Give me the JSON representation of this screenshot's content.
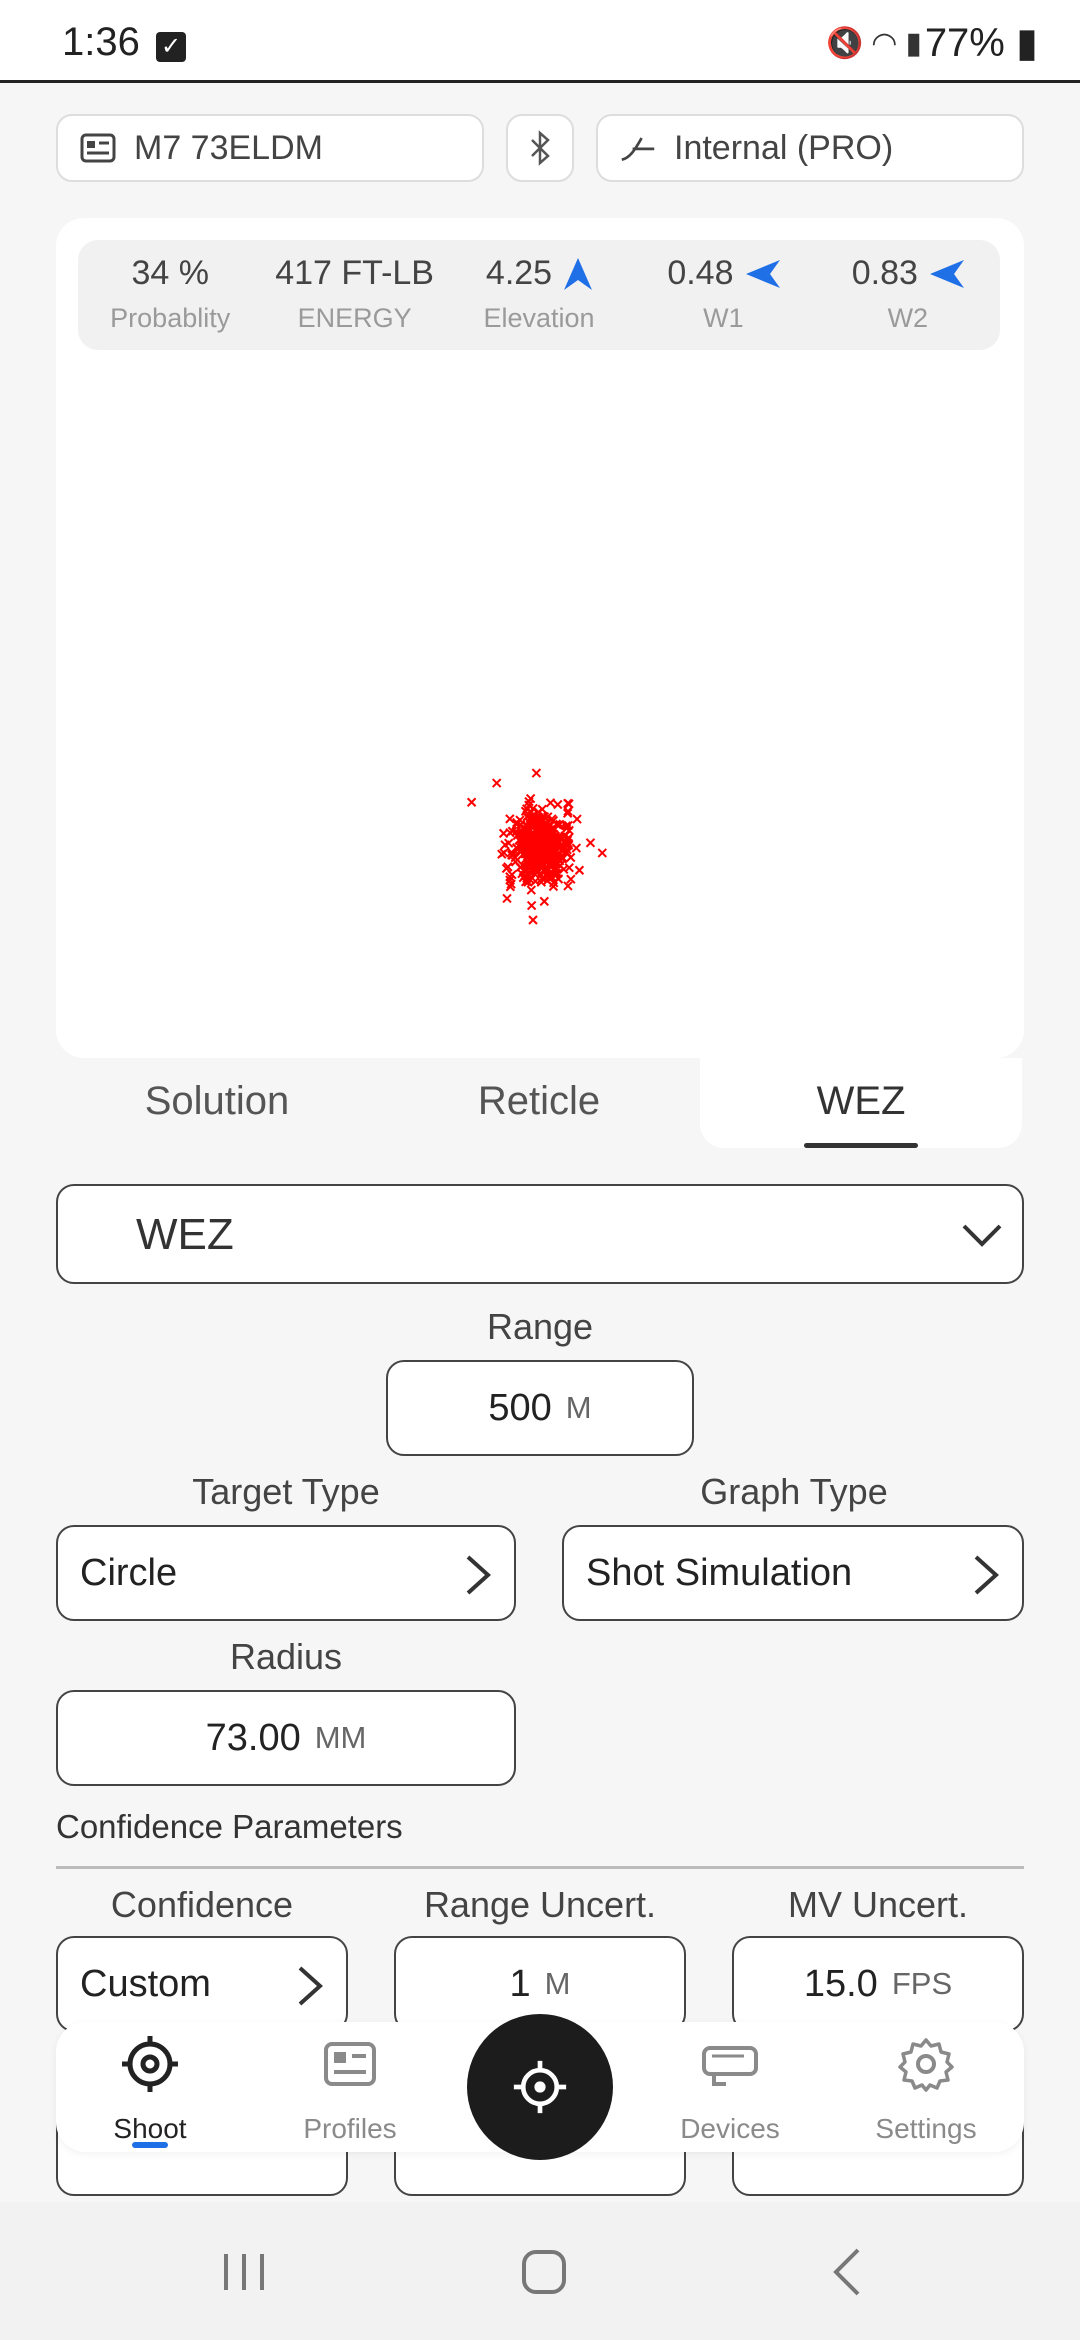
{
  "status_bar": {
    "time": "1:36",
    "battery": "77%"
  },
  "top_bar": {
    "profile_name": "M7 73ELDM",
    "solver": "Internal (PRO)"
  },
  "metrics": [
    {
      "value": "34 %",
      "label": "Probablity"
    },
    {
      "value": "417 FT-LB",
      "label": "ENERGY"
    },
    {
      "value": "4.25",
      "label": "Elevation",
      "arrow": "up"
    },
    {
      "value": "0.48",
      "label": "W1",
      "arrow": "left"
    },
    {
      "value": "0.83",
      "label": "W2",
      "arrow": "left"
    }
  ],
  "tabs": [
    {
      "label": "Solution",
      "active": false
    },
    {
      "label": "Reticle",
      "active": false
    },
    {
      "label": "WEZ",
      "active": true
    }
  ],
  "wez": {
    "mode": "WEZ",
    "range_label": "Range",
    "range_value": "500",
    "range_unit": "M",
    "target_type_label": "Target Type",
    "target_type_value": "Circle",
    "graph_type_label": "Graph Type",
    "graph_type_value": "Shot Simulation",
    "radius_label": "Radius",
    "radius_value": "73.00",
    "radius_unit": "MM"
  },
  "confidence": {
    "section_title": "Confidence Parameters",
    "confidence_label": "Confidence",
    "confidence_value": "Custom",
    "range_uncert_label": "Range Uncert.",
    "range_uncert_value": "1",
    "range_uncert_unit": "M",
    "mv_uncert_label": "MV Uncert.",
    "mv_uncert_value": "15.0",
    "mv_uncert_unit": "FPS"
  },
  "nav": {
    "shoot": "Shoot",
    "profiles": "Profiles",
    "devices": "Devices",
    "settings": "Settings"
  },
  "colors": {
    "accent": "#1f6fe6",
    "hits": "#ff0000",
    "fab": "#1c1c1c"
  }
}
